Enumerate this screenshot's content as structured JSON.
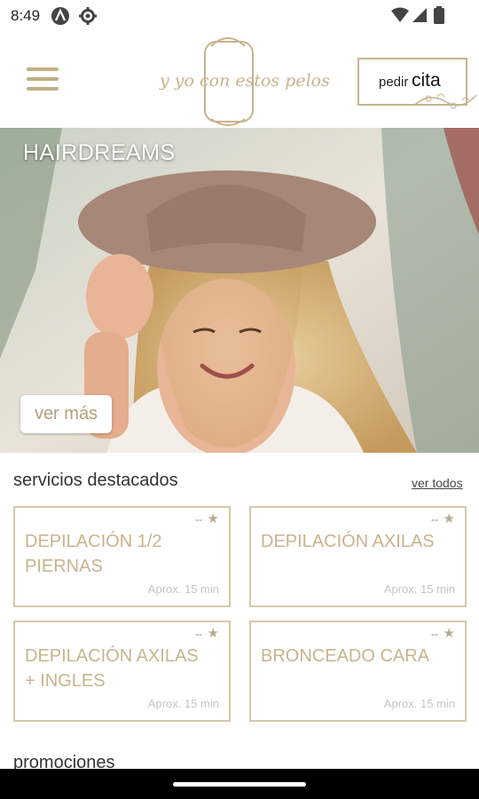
{
  "status_bar": {
    "time": "8:49",
    "icons_left": [
      "a-app-icon",
      "settings-gear-icon"
    ],
    "icons_right": [
      "wifi-icon",
      "cellular-signal-icon",
      "battery-icon"
    ]
  },
  "header": {
    "logo_text": "y yo con estos pelos",
    "cta_small": "pedir",
    "cta_big": "cita",
    "accent": "#c7b48d"
  },
  "hero": {
    "title": "HAIRDREAMS",
    "button_label": "ver más"
  },
  "featured": {
    "title": "servicios destacados",
    "link": "ver todos",
    "cards": [
      {
        "name": "DEPILACIÓN 1/2 PIERNAS",
        "price": "--",
        "duration": "Aprox. 15 min"
      },
      {
        "name": "DEPILACIÓN AXILAS",
        "price": "--",
        "duration": "Aprox. 15 min"
      },
      {
        "name": "DEPILACIÓN AXILAS + INGLES",
        "price": "--",
        "duration": "Aprox. 15 min"
      },
      {
        "name": "BRONCEADO CARA",
        "price": "--",
        "duration": "Aprox. 15 min"
      }
    ]
  },
  "promos": {
    "title": "promociones"
  }
}
